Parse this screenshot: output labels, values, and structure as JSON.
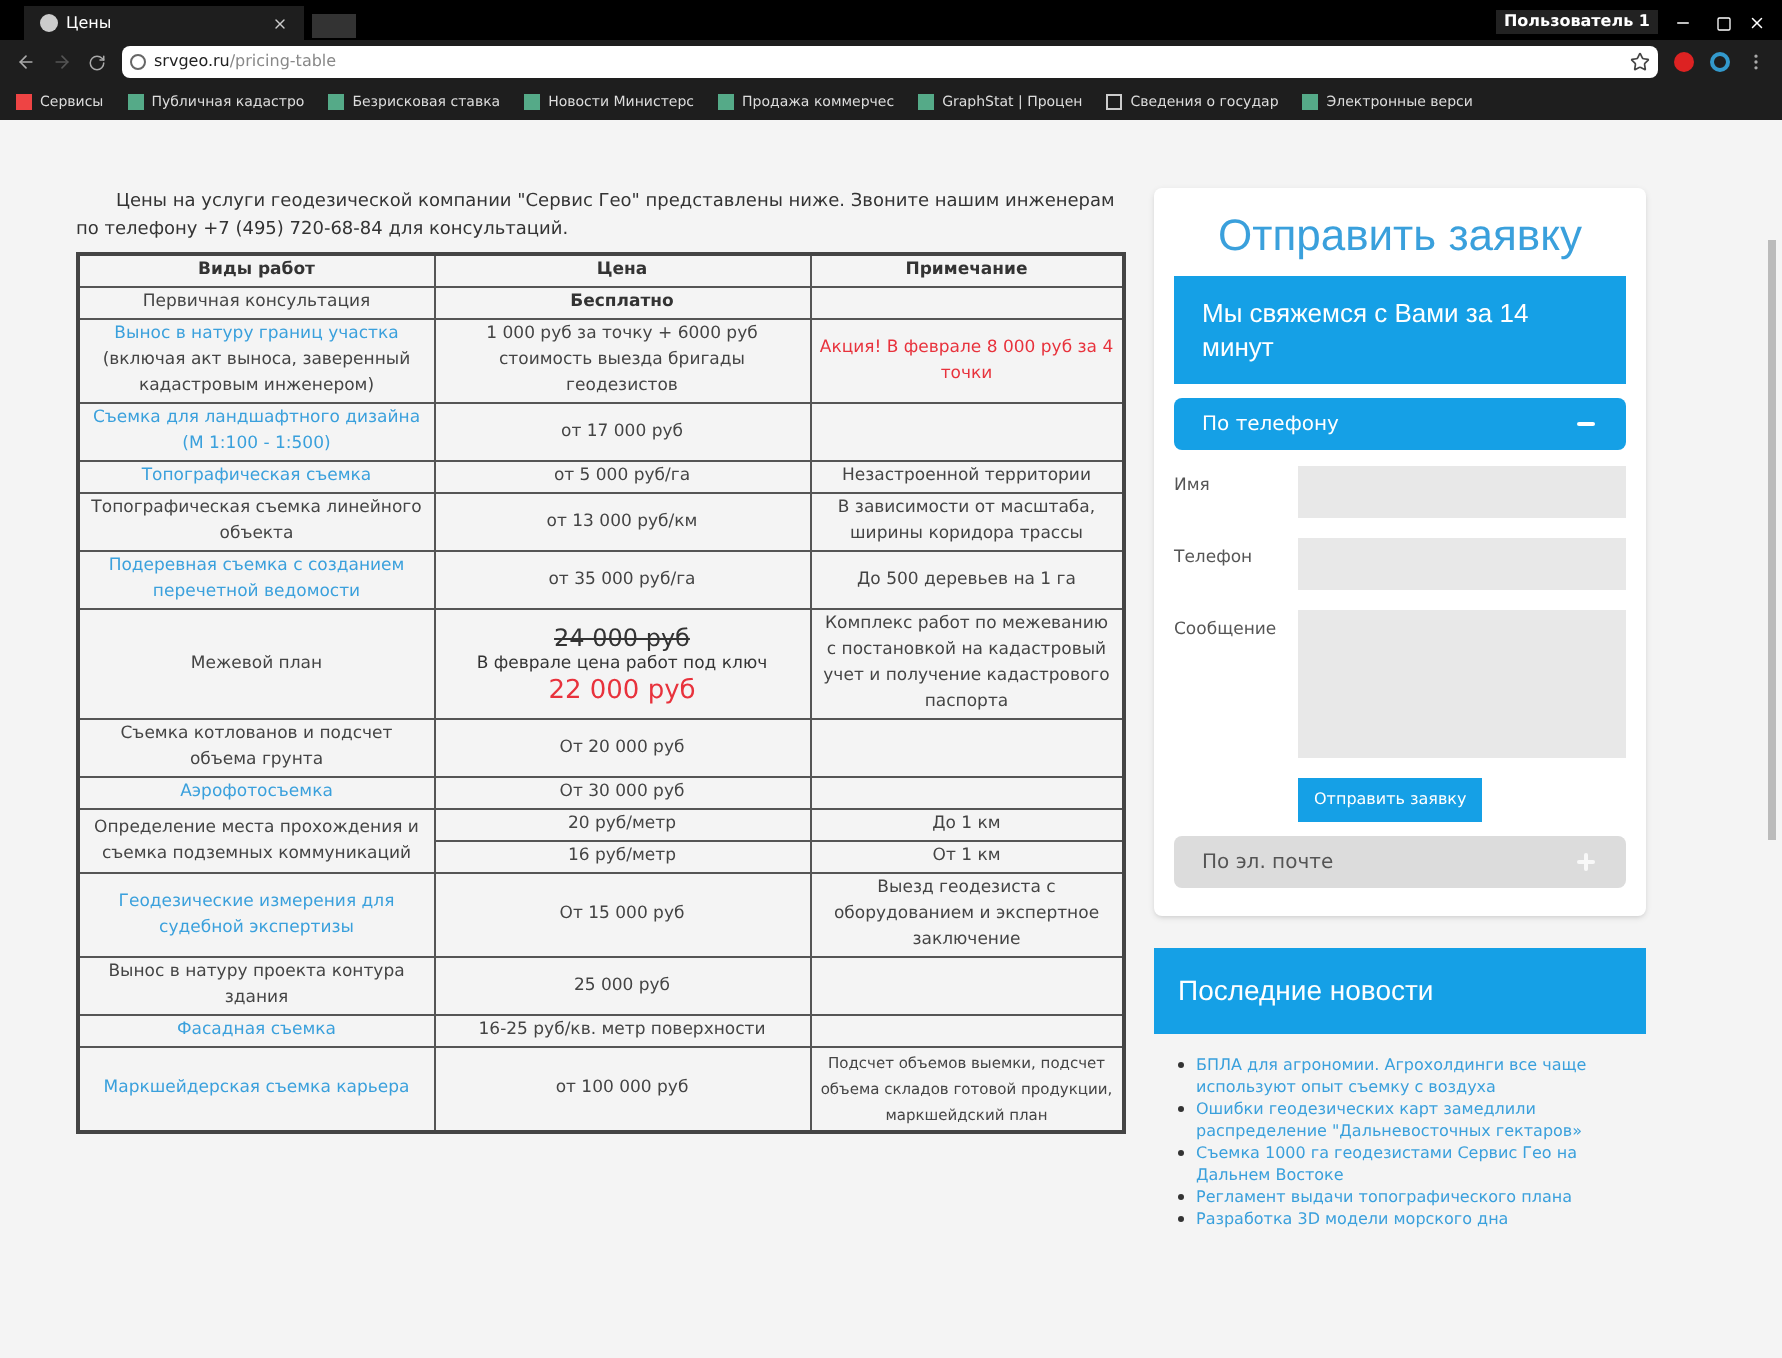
{
  "browser": {
    "tab_title": "Цены",
    "user": "Пользователь 1",
    "url_host": "srvgeo.ru",
    "url_path": "/pricing-table",
    "bookmarks": [
      {
        "label": "Сервисы",
        "kind": "apps"
      },
      {
        "label": "Публичная кадастро",
        "kind": "page"
      },
      {
        "label": "Безрисковая ставка",
        "kind": "page"
      },
      {
        "label": "Новости Министерс",
        "kind": "page"
      },
      {
        "label": "Продажа коммерчес",
        "kind": "page"
      },
      {
        "label": "GraphStat | Процен",
        "kind": "page"
      },
      {
        "label": "Сведения о государ",
        "kind": "doc"
      },
      {
        "label": "Электронные верси",
        "kind": "page"
      }
    ]
  },
  "intro": "Цены на услуги геодезической компании \"Сервис Гео\" представлены ниже. Звоните нашим инженерам по телефону +7 (495) 720-68-84 для консультаций.",
  "table": {
    "columns": [
      "Виды работ",
      "Цена",
      "Примечание"
    ],
    "rows": [
      {
        "work": "Первичная консультация",
        "link": false,
        "prices": [
          {
            "kind": "bold",
            "text": "Бесплатно"
          }
        ]
      },
      {
        "work": "Вынос в натуру границ участка",
        "link": true,
        "work_extra": "(включая акт выноса, заверенный кадастровым инженером)",
        "prices": [
          {
            "kind": "plain",
            "text": "1 000 руб за точку + 6000 руб стоимость выезда бригады геодезистов",
            "note": "Акция! В феврале 8 000 руб за 4 точки",
            "note_highlight": true
          }
        ]
      },
      {
        "work": "Съемка для ландшафтного дизайна (М 1:100 - 1:500)",
        "link": true,
        "prices": [
          {
            "kind": "plain",
            "text": "от 17 000 руб"
          }
        ]
      },
      {
        "work": "Топографическая съемка",
        "link": true,
        "prices": [
          {
            "kind": "plain",
            "text": "от 5 000 руб/га",
            "note": "Незастроенной территории",
            "note_highlight": false
          }
        ]
      },
      {
        "work": "Топографическая съемка линейного объекта",
        "link": false,
        "prices": [
          {
            "kind": "plain",
            "text": "от 13 000 руб/км",
            "note": "В зависимости от масштаба, ширины коридора трассы",
            "note_highlight": false
          }
        ]
      },
      {
        "work": "Подеревная съемка с созданием перечетной ведомости",
        "link": true,
        "prices": [
          {
            "kind": "plain",
            "text": "от 35 000 руб/га",
            "note": "До 500 деревьев на 1 га",
            "note_highlight": false
          }
        ]
      },
      {
        "work": "Межевой план",
        "link": false,
        "prices": [
          {
            "kind": "promo",
            "old": "24 000 руб",
            "text": "В феврале цена работ под ключ",
            "new": "22 000 руб",
            "note": "Комплекс работ по межеванию с постановкой на кадастровый учет и получение кадастрового паспорта",
            "note_highlight": false
          }
        ]
      },
      {
        "work": "Съемка котлованов и подсчет объема грунта",
        "link": false,
        "prices": [
          {
            "kind": "plain",
            "text": "От 20 000 руб"
          }
        ]
      },
      {
        "work": "Аэрофотосъемка",
        "link": true,
        "prices": [
          {
            "kind": "plain",
            "text": "От 30 000 руб"
          }
        ]
      },
      {
        "work": "Определение места прохождения и съемка подземных коммуникаций",
        "link": false,
        "prices": [
          {
            "kind": "plain",
            "text": "20 руб/метр",
            "note": "До 1 км",
            "note_highlight": false
          },
          {
            "kind": "plain",
            "text": "16 руб/метр",
            "note": "От 1 км",
            "note_highlight": false
          }
        ]
      },
      {
        "work": "Геодезические измерения для судебной экспертизы",
        "link": true,
        "prices": [
          {
            "kind": "plain",
            "text": "От 15 000 руб",
            "note": "Выезд геодезиста с оборудованием и экспертное заключение",
            "note_highlight": false
          }
        ]
      },
      {
        "work": "Вынос в натуру проекта контура здания",
        "link": false,
        "prices": [
          {
            "kind": "plain",
            "text": "25 000 руб"
          }
        ]
      },
      {
        "work": "Фасадная съемка",
        "link": true,
        "prices": [
          {
            "kind": "plain",
            "text": "16-25 руб/кв. метр поверхности"
          }
        ]
      },
      {
        "work": "Маркшейдерская съемка карьера",
        "link": true,
        "prices": [
          {
            "kind": "plain",
            "text": "от 100 000 руб",
            "note": "Подсчет объемов выемки, подсчет объема складов готовой продукции, маркшейдский план",
            "note_highlight": false
          }
        ]
      }
    ]
  },
  "form": {
    "title": "Отправить заявку",
    "banner": "Мы свяжемся с Вами за 14 минут",
    "sections": [
      {
        "label": "По телефону",
        "expanded": true
      },
      {
        "label": "По эл. почте",
        "expanded": false
      }
    ],
    "fields": [
      {
        "label": "Имя",
        "kind": "input"
      },
      {
        "label": "Телефон",
        "kind": "input"
      },
      {
        "label": "Сообщение",
        "kind": "textarea"
      }
    ],
    "submit": "Отправить заявку"
  },
  "news": {
    "title": "Последние новости",
    "items": [
      "БПЛА для агрономии. Агрохолдинги все чаще используют опыт съемку с воздуха",
      "Ошибки геодезических карт замедлили распределение \"Дальневосточных гектаров»",
      "Съемка 1000 га геодезистами Сервис Гео на Дальнем Востоке",
      "Регламент выдачи топографического плана",
      "Разработка 3D модели морского дна"
    ]
  }
}
